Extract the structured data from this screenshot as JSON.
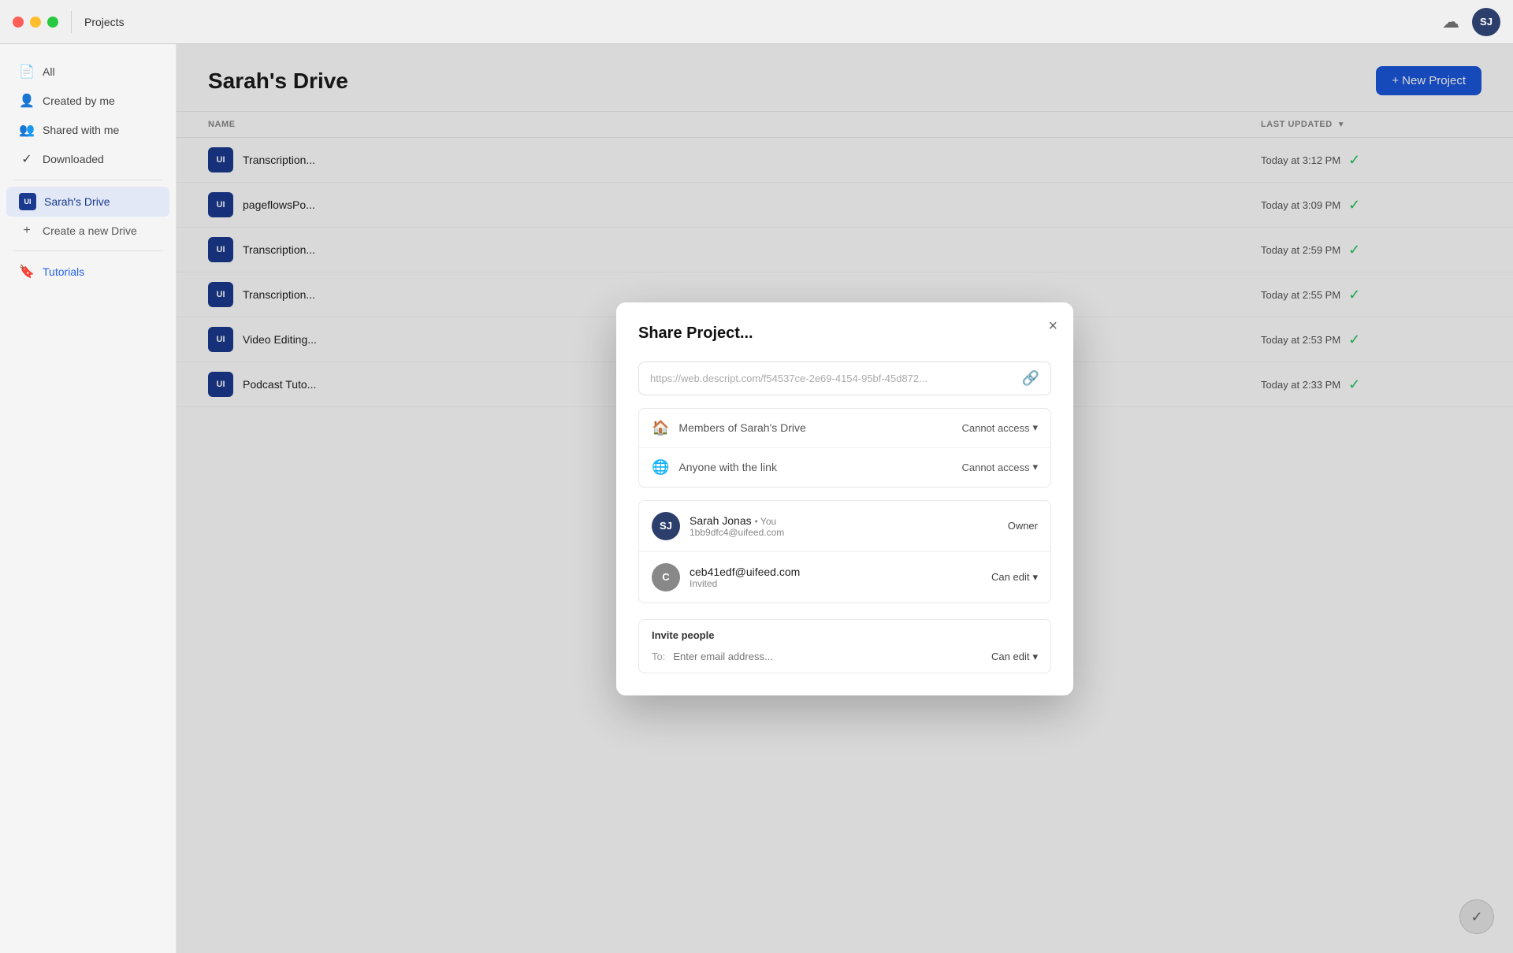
{
  "titlebar": {
    "title": "Projects",
    "avatar_initials": "SJ"
  },
  "sidebar": {
    "items": [
      {
        "id": "all",
        "label": "All",
        "icon": "📄"
      },
      {
        "id": "created-by-me",
        "label": "Created by me",
        "icon": "👤"
      },
      {
        "id": "shared-with-me",
        "label": "Shared with me",
        "icon": "👥"
      },
      {
        "id": "downloaded",
        "label": "Downloaded",
        "icon": "✓"
      }
    ],
    "drives": [
      {
        "id": "sarahs-drive",
        "label": "Sarah's Drive",
        "icon": "UI",
        "active": true
      }
    ],
    "create_drive": "Create a new Drive",
    "tutorials": "Tutorials"
  },
  "content": {
    "title": "Sarah's Drive",
    "new_project_label": "+ New Project",
    "table": {
      "columns": [
        {
          "id": "name",
          "label": "NAME"
        },
        {
          "id": "last_updated",
          "label": "LAST UPDATED"
        }
      ],
      "rows": [
        {
          "id": 1,
          "icon": "UI",
          "name": "Transcription...",
          "last_updated": "Today at 3:12 PM",
          "synced": true
        },
        {
          "id": 2,
          "icon": "UI",
          "name": "pageflowsPo...",
          "last_updated": "Today at 3:09 PM",
          "synced": true
        },
        {
          "id": 3,
          "icon": "UI",
          "name": "Transcription...",
          "last_updated": "Today at 2:59 PM",
          "synced": true
        },
        {
          "id": 4,
          "icon": "UI",
          "name": "Transcription...",
          "last_updated": "Today at 2:55 PM",
          "synced": true
        },
        {
          "id": 5,
          "icon": "UI",
          "name": "Video Editing...",
          "last_updated": "Today at 2:53 PM",
          "synced": true
        },
        {
          "id": 6,
          "icon": "UI",
          "name": "Podcast Tuto...",
          "last_updated": "Today at 2:33 PM",
          "synced": true
        }
      ]
    }
  },
  "modal": {
    "title": "Share Project...",
    "close_label": "×",
    "link_url": "https://web.descript.com/f54537ce-2e69-4154-95bf-45d872...",
    "access_rows": [
      {
        "id": "members",
        "icon": "🏠",
        "label": "Members of Sarah's Drive",
        "access": "Cannot access"
      },
      {
        "id": "anyone",
        "icon": "🌐",
        "label": "Anyone with the link",
        "access": "Cannot access"
      }
    ],
    "members": [
      {
        "id": "sarah",
        "initials": "SJ",
        "avatar_style": "dark",
        "name": "Sarah Jonas",
        "sub": "• You",
        "email": "1bb9dfc4@uifeed.com",
        "role": "Owner"
      },
      {
        "id": "ceb",
        "initials": "C",
        "avatar_style": "gray",
        "name": "ceb41edf@uifeed.com",
        "sub": "",
        "email": "Invited",
        "role": "Can edit"
      }
    ],
    "invite_section": {
      "label": "Invite people",
      "to_label": "To:",
      "placeholder": "Enter email address...",
      "permission": "Can edit"
    }
  }
}
